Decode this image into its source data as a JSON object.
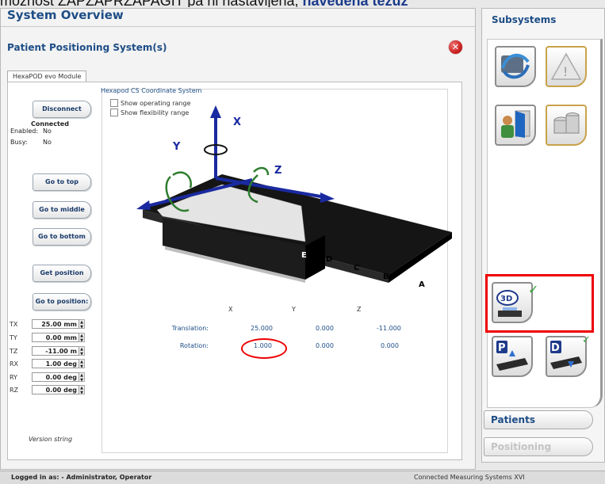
{
  "top_banner": {
    "prefix": "moznost ZAPZAPRZAPAGIT pa ni nastavijena, ",
    "suffix": "navedena tezuz"
  },
  "main_window": {
    "title": "System Overview",
    "subtitle": "Patient Positioning System(s)",
    "close_glyph": "✕",
    "tab_label": "HexaPOD evo Module",
    "coord_system_title": "Hexapod CS Coordinate System",
    "checkboxes": [
      {
        "label": "Show operating range",
        "checked": false
      },
      {
        "label": "Show flexibility range",
        "checked": false
      }
    ],
    "buttons": {
      "disconnect": "Disconnect",
      "go_top": "Go to top",
      "go_middle": "Go to middle",
      "go_bottom": "Go to bottom",
      "get_position": "Get position",
      "go_to_position": "Go to position:"
    },
    "status": {
      "connected": "Connected",
      "enabled_label": "Enabled:",
      "enabled_value": "No",
      "busy_label": "Busy:",
      "busy_value": "No"
    },
    "fields": [
      {
        "label": "TX",
        "value": "25.00 mm"
      },
      {
        "label": "TY",
        "value": "0.00 mm"
      },
      {
        "label": "TZ",
        "value": "-11.00 m"
      },
      {
        "label": "RX",
        "value": "1.00 deg"
      },
      {
        "label": "RY",
        "value": "0.00 deg"
      },
      {
        "label": "RZ",
        "value": "0.00 deg"
      }
    ],
    "diagram": {
      "axis_x": "X",
      "axis_y": "Y",
      "axis_z": "Z",
      "markers": [
        "A",
        "B",
        "C",
        "D",
        "E"
      ]
    },
    "table": {
      "headers": [
        "X",
        "Y",
        "Z"
      ],
      "rows": [
        {
          "label": "Translation:",
          "values": [
            "25.000",
            "0.000",
            "-11.000"
          ]
        },
        {
          "label": "Rotation:",
          "values": [
            "1.000",
            "0.000",
            "0.000"
          ]
        }
      ]
    },
    "version": "Version string"
  },
  "side_panel": {
    "title": "Subsystems",
    "tiles": [
      {
        "name": "network-icon"
      },
      {
        "name": "warning-icon"
      },
      {
        "name": "user-exit-icon"
      },
      {
        "name": "database-icon"
      },
      {
        "name": "3d-view-icon",
        "badge": "3D"
      },
      {
        "name": "patient-load-icon",
        "badge": "P"
      },
      {
        "name": "patient-unload-icon",
        "badge": "D"
      }
    ],
    "buttons": {
      "patients": "Patients",
      "positioning": "Positioning"
    }
  },
  "statusbar": {
    "logged_in": "Logged in as: - Administrator, Operator",
    "connected_systems": "Connected Measuring Systems  XVI"
  },
  "colors": {
    "title_blue": "#1d4d86",
    "highlight_red": "#e00000",
    "axis_blue": "#1a2aa0",
    "rotation_green": "#2e7d2e"
  }
}
